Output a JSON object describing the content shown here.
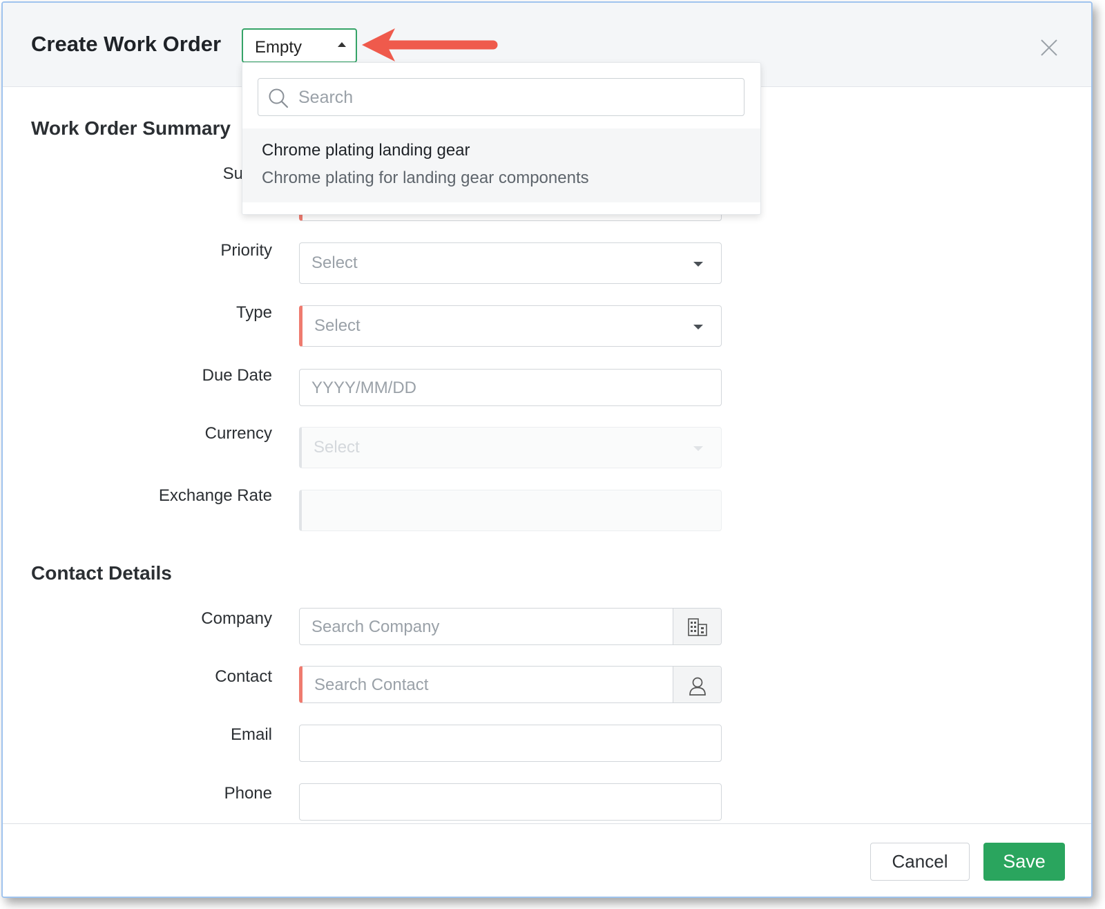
{
  "dialog": {
    "title": "Create Work Order",
    "layout_select": {
      "value": "Empty"
    },
    "close_icon": "close-icon"
  },
  "layout_popup": {
    "search_placeholder": "Search",
    "items": [
      {
        "name": "Chrome plating landing gear",
        "description": "Chrome plating for landing gear components"
      }
    ]
  },
  "sections": {
    "summary": {
      "title": "Work Order Summary"
    },
    "contact": {
      "title": "Contact Details"
    }
  },
  "fields": {
    "summary_label": "Sumr",
    "priority": {
      "label": "Priority",
      "placeholder": "Select"
    },
    "type": {
      "label": "Type",
      "placeholder": "Select"
    },
    "due_date": {
      "label": "Due Date",
      "placeholder": "YYYY/MM/DD"
    },
    "currency": {
      "label": "Currency",
      "placeholder": "Select"
    },
    "exchange_rate": {
      "label": "Exchange Rate"
    },
    "company": {
      "label": "Company",
      "placeholder": "Search Company",
      "icon": "building-icon"
    },
    "contact": {
      "label": "Contact",
      "placeholder": "Search Contact",
      "icon": "person-icon"
    },
    "email": {
      "label": "Email"
    },
    "phone": {
      "label": "Phone"
    }
  },
  "footer": {
    "cancel": "Cancel",
    "save": "Save"
  },
  "colors": {
    "accent_green": "#2aa55e",
    "required_bar": "#ef7b6f",
    "annotation_arrow": "#ef5a4c",
    "frame_border": "#9fc3ee"
  }
}
